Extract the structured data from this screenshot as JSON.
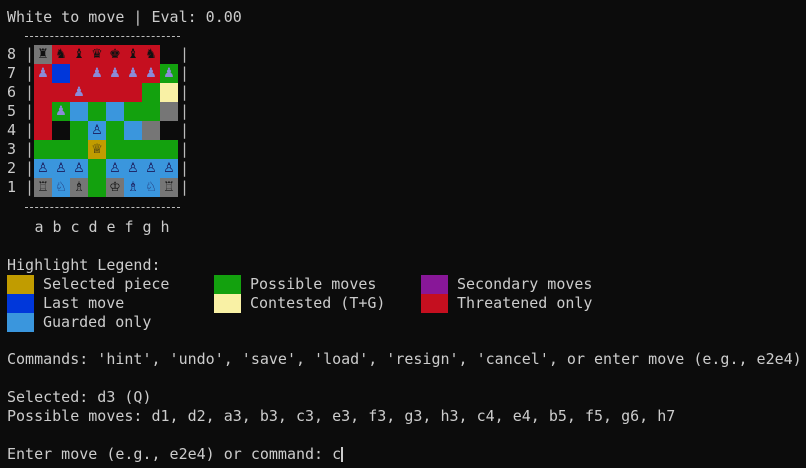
{
  "header": {
    "status": "White to move | Eval: 0.00"
  },
  "board": {
    "ranks": [
      "8",
      "7",
      "6",
      "5",
      "4",
      "3",
      "2",
      "1"
    ],
    "files": [
      "a",
      "b",
      "c",
      "d",
      "e",
      "f",
      "g",
      "h"
    ],
    "squares": [
      [
        {
          "c": "#767676",
          "p": "♜",
          "pc": "#111"
        },
        {
          "c": "#c50f1f",
          "p": "♞",
          "pc": "#111"
        },
        {
          "c": "#c50f1f",
          "p": "♝",
          "pc": "#111"
        },
        {
          "c": "#c50f1f",
          "p": "♛",
          "pc": "#111"
        },
        {
          "c": "#c50f1f",
          "p": "♚",
          "pc": "#111"
        },
        {
          "c": "#c50f1f",
          "p": "♝",
          "pc": "#111"
        },
        {
          "c": "#c50f1f",
          "p": "♞",
          "pc": "#111"
        },
        {
          "c": "#0c0c0c",
          "p": "",
          "pc": "#111"
        }
      ],
      [
        {
          "c": "#c50f1f",
          "p": "♟",
          "pc": "#8b8bd8"
        },
        {
          "c": "#0037da",
          "p": "",
          "pc": "#111"
        },
        {
          "c": "#c50f1f",
          "p": "",
          "pc": "#111"
        },
        {
          "c": "#c50f1f",
          "p": "♟",
          "pc": "#8b8bd8"
        },
        {
          "c": "#c50f1f",
          "p": "♟",
          "pc": "#8b8bd8"
        },
        {
          "c": "#c50f1f",
          "p": "♟",
          "pc": "#8b8bd8"
        },
        {
          "c": "#c50f1f",
          "p": "♟",
          "pc": "#8b8bd8"
        },
        {
          "c": "#13a10e",
          "p": "♟",
          "pc": "#8b8bd8"
        }
      ],
      [
        {
          "c": "#c50f1f",
          "p": "",
          "pc": "#111"
        },
        {
          "c": "#c50f1f",
          "p": "",
          "pc": "#111"
        },
        {
          "c": "#c50f1f",
          "p": "♟",
          "pc": "#8b8bd8"
        },
        {
          "c": "#c50f1f",
          "p": "",
          "pc": "#111"
        },
        {
          "c": "#c50f1f",
          "p": "",
          "pc": "#111"
        },
        {
          "c": "#c50f1f",
          "p": "",
          "pc": "#111"
        },
        {
          "c": "#13a10e",
          "p": "",
          "pc": "#111"
        },
        {
          "c": "#f9f1a5",
          "p": "",
          "pc": "#111"
        }
      ],
      [
        {
          "c": "#c50f1f",
          "p": "",
          "pc": "#111"
        },
        {
          "c": "#13a10e",
          "p": "♟",
          "pc": "#8b8bd8"
        },
        {
          "c": "#3a96dd",
          "p": "",
          "pc": "#111"
        },
        {
          "c": "#13a10e",
          "p": "",
          "pc": "#111"
        },
        {
          "c": "#3a96dd",
          "p": "",
          "pc": "#111"
        },
        {
          "c": "#13a10e",
          "p": "",
          "pc": "#111"
        },
        {
          "c": "#13a10e",
          "p": "",
          "pc": "#111"
        },
        {
          "c": "#767676",
          "p": "",
          "pc": "#111"
        }
      ],
      [
        {
          "c": "#c50f1f",
          "p": "",
          "pc": "#111"
        },
        {
          "c": "#0c0c0c",
          "p": "",
          "pc": "#111"
        },
        {
          "c": "#13a10e",
          "p": "",
          "pc": "#111"
        },
        {
          "c": "#3a96dd",
          "p": "♙",
          "pc": "#1a1a5a"
        },
        {
          "c": "#13a10e",
          "p": "",
          "pc": "#111"
        },
        {
          "c": "#3a96dd",
          "p": "",
          "pc": "#111"
        },
        {
          "c": "#767676",
          "p": "",
          "pc": "#111"
        },
        {
          "c": "#0c0c0c",
          "p": "",
          "pc": "#111"
        }
      ],
      [
        {
          "c": "#13a10e",
          "p": "",
          "pc": "#111"
        },
        {
          "c": "#13a10e",
          "p": "",
          "pc": "#111"
        },
        {
          "c": "#13a10e",
          "p": "",
          "pc": "#111"
        },
        {
          "c": "#c19c00",
          "p": "♕",
          "pc": "#1a1a1a"
        },
        {
          "c": "#13a10e",
          "p": "",
          "pc": "#111"
        },
        {
          "c": "#13a10e",
          "p": "",
          "pc": "#111"
        },
        {
          "c": "#13a10e",
          "p": "",
          "pc": "#111"
        },
        {
          "c": "#13a10e",
          "p": "",
          "pc": "#111"
        }
      ],
      [
        {
          "c": "#3a96dd",
          "p": "♙",
          "pc": "#1a1a5a"
        },
        {
          "c": "#3a96dd",
          "p": "♙",
          "pc": "#1a1a5a"
        },
        {
          "c": "#3a96dd",
          "p": "♙",
          "pc": "#1a1a5a"
        },
        {
          "c": "#13a10e",
          "p": "",
          "pc": "#111"
        },
        {
          "c": "#3a96dd",
          "p": "♙",
          "pc": "#1a1a5a"
        },
        {
          "c": "#3a96dd",
          "p": "♙",
          "pc": "#1a1a5a"
        },
        {
          "c": "#3a96dd",
          "p": "♙",
          "pc": "#1a1a5a"
        },
        {
          "c": "#3a96dd",
          "p": "♙",
          "pc": "#1a1a5a"
        }
      ],
      [
        {
          "c": "#767676",
          "p": "♖",
          "pc": "#111"
        },
        {
          "c": "#3a96dd",
          "p": "♘",
          "pc": "#1a1a5a"
        },
        {
          "c": "#767676",
          "p": "♗",
          "pc": "#111"
        },
        {
          "c": "#13a10e",
          "p": "",
          "pc": "#111"
        },
        {
          "c": "#767676",
          "p": "♔",
          "pc": "#111"
        },
        {
          "c": "#3a96dd",
          "p": "♗",
          "pc": "#1a1a5a"
        },
        {
          "c": "#3a96dd",
          "p": "♘",
          "pc": "#1a1a5a"
        },
        {
          "c": "#767676",
          "p": "♖",
          "pc": "#111"
        }
      ]
    ]
  },
  "legend": {
    "title": "Highlight Legend:",
    "items": [
      {
        "label": "Selected piece",
        "color": "#c19c00"
      },
      {
        "label": "Possible moves",
        "color": "#13a10e"
      },
      {
        "label": "Secondary moves",
        "color": "#881798"
      },
      {
        "label": "Last move",
        "color": "#0037da"
      },
      {
        "label": "Contested (T+G)",
        "color": "#f9f1a5"
      },
      {
        "label": "Threatened only",
        "color": "#c50f1f"
      },
      {
        "label": "Guarded only",
        "color": "#3a96dd"
      }
    ]
  },
  "commands_line": "Commands: 'hint', 'undo', 'save', 'load', 'resign', 'cancel', or enter move (e.g., e2e4)",
  "selected_line": "Selected: d3 (Q)",
  "possible_line": "Possible moves: d1, d2, a3, b3, c3, e3, f3, g3, h3, c4, e4, b5, f5, g6, h7",
  "prompt": {
    "text": "Enter move (e.g., e2e4) or command: ",
    "input": "c"
  }
}
